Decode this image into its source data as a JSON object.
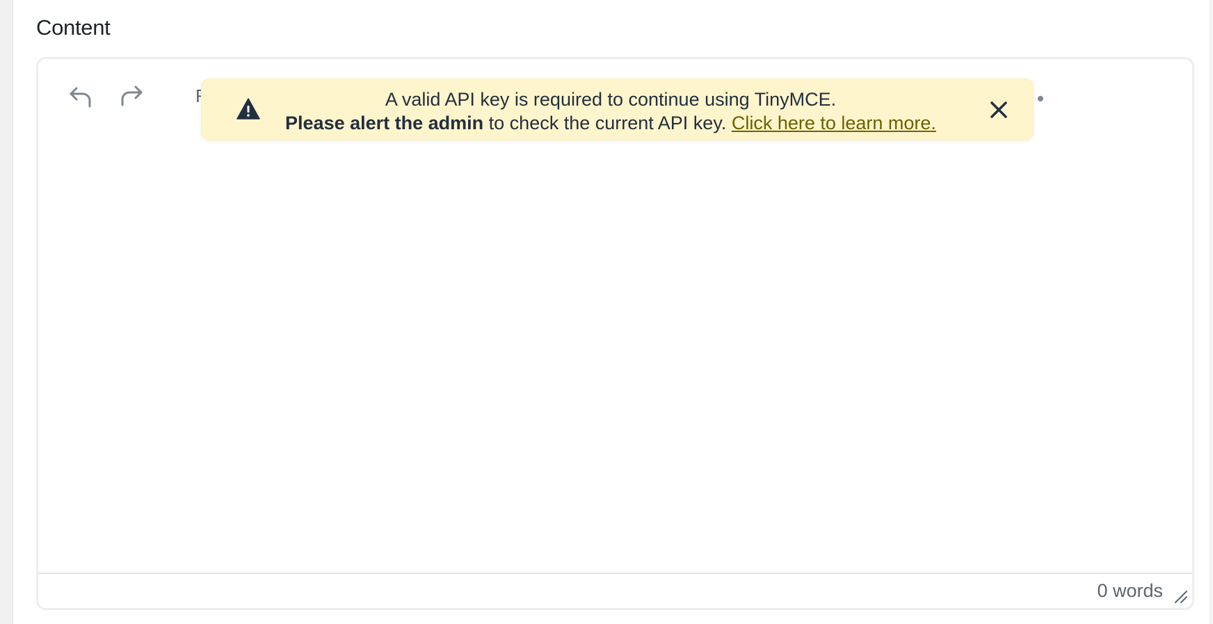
{
  "field": {
    "label": "Content"
  },
  "toolbar": {
    "undo_icon": "undo-icon",
    "redo_icon": "redo-icon",
    "format_partial": "F",
    "more_icon": "more-icon"
  },
  "notice": {
    "line1": "A valid API key is required to continue using TinyMCE.",
    "line2_bold": "Please alert the admin",
    "line2_text": " to check the current API key. ",
    "link": "Click here to learn more.",
    "icon": "warning-icon",
    "close_icon": "close-icon",
    "background": "#fff5cc"
  },
  "statusbar": {
    "word_count": "0 words",
    "resize_icon": "resize-handle-icon"
  }
}
